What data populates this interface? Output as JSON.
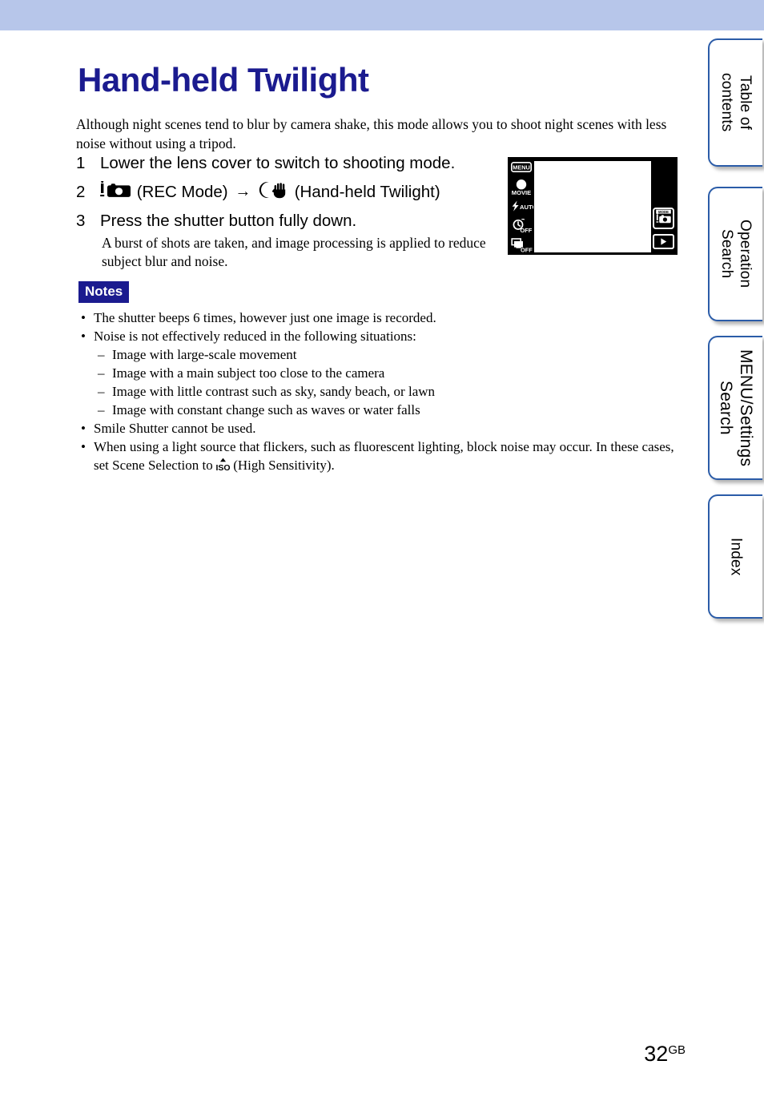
{
  "document": {
    "title": "Hand-held Twilight",
    "intro": "Although night scenes tend to blur by camera shake, this mode allows you to shoot night scenes with less noise without using a tripod.",
    "page_number": "32",
    "page_number_suffix": "GB"
  },
  "steps": [
    {
      "num": "1",
      "text": "Lower the lens cover to switch to shooting mode.",
      "sub": ""
    },
    {
      "num": "2",
      "text_before_icon": "",
      "label_rec": "(REC Mode)",
      "label_mode": "(Hand-held Twilight)",
      "arrow": "→",
      "icon_rec": "i-camera-icon",
      "icon_mode": "moon-hand-icon",
      "sub": ""
    },
    {
      "num": "3",
      "text": "Press the shutter button fully down.",
      "sub": "A burst of shots are taken, and image processing is applied to reduce subject blur and noise."
    }
  ],
  "lcd": {
    "left_icons": [
      {
        "name": "menu-button-icon",
        "label": "MENU"
      },
      {
        "name": "movie-mode-icon",
        "label": "MOVIE"
      },
      {
        "name": "flash-auto-icon",
        "label": "AUTO"
      },
      {
        "name": "self-timer-off-icon",
        "label": "OFF"
      },
      {
        "name": "burst-mode-off-icon",
        "label": "OFF"
      }
    ],
    "right_buttons": [
      {
        "name": "mode-button",
        "label": "MODE"
      },
      {
        "name": "playback-button",
        "label": "▶"
      }
    ]
  },
  "notes": {
    "label": "Notes",
    "items": [
      {
        "text": "The shutter beeps 6 times, however just one image is recorded.",
        "children": []
      },
      {
        "text": "Noise is not effectively reduced in the following situations:",
        "children": [
          "Image with large-scale movement",
          "Image with a main subject too close to the camera",
          "Image with little contrast such as sky, sandy beach, or lawn",
          "Image with constant change such as waves or water falls"
        ]
      },
      {
        "text": "Smile Shutter cannot be used.",
        "children": []
      },
      {
        "text_before_icon": "When using a light source that flickers, such as fluorescent lighting, block noise may occur. In these cases, set Scene Selection to ",
        "icon": "iso-high-sensitivity-icon",
        "text_after_icon": " (High Sensitivity).",
        "children": []
      }
    ],
    "bullet_glyph": "•",
    "dash_glyph": "–"
  },
  "tabs": [
    {
      "name": "tab-table-of-contents",
      "label": "Table of\ncontents"
    },
    {
      "name": "tab-operation-search",
      "label": "Operation\nSearch"
    },
    {
      "name": "tab-menu-settings-search",
      "label": "MENU/Settings\nSearch"
    },
    {
      "name": "tab-index",
      "label": "Index"
    }
  ],
  "colors": {
    "band": "#b7c6ea",
    "title": "#1b1b8f",
    "notes_badge": "#1b1b8f",
    "tab_border": "#2b5ca8"
  }
}
